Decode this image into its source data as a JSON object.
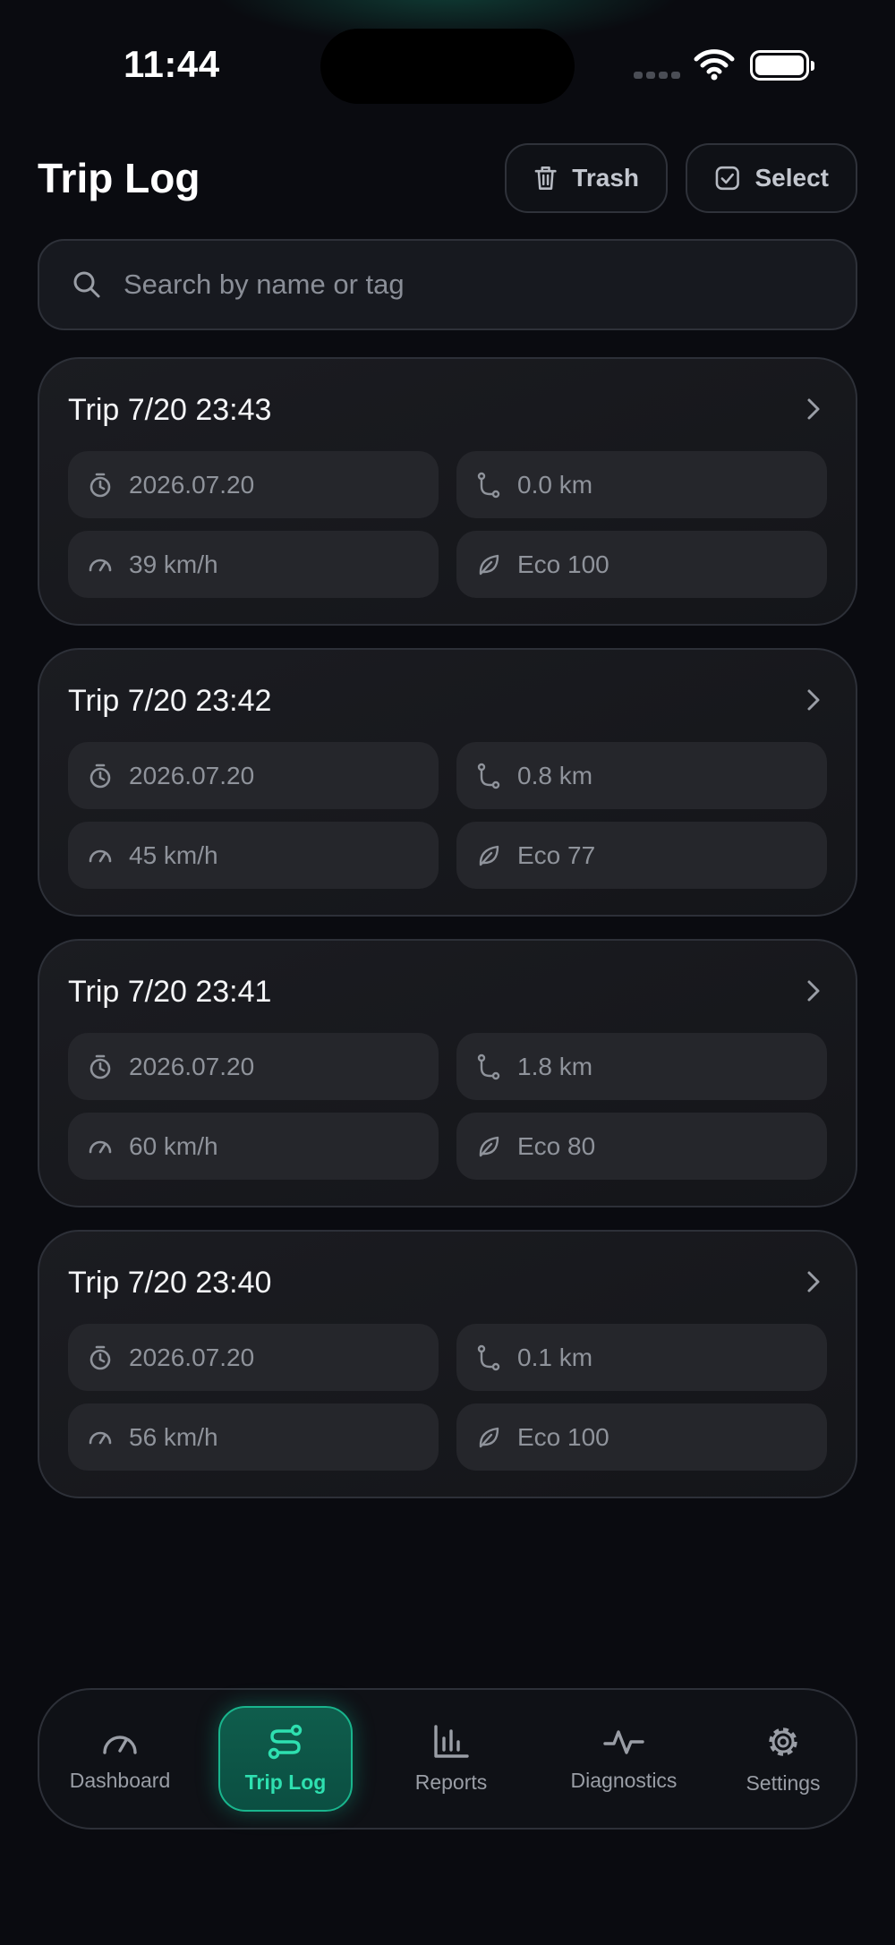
{
  "status_bar": {
    "time": "11:44"
  },
  "header": {
    "title": "Trip Log",
    "trash_label": "Trash",
    "select_label": "Select"
  },
  "search": {
    "placeholder": "Search by name or tag"
  },
  "trips": [
    {
      "name": "Trip 7/20 23:43",
      "date": "2026.07.20",
      "distance": "0.0 km",
      "speed": "39 km/h",
      "eco": "Eco 100"
    },
    {
      "name": "Trip 7/20 23:42",
      "date": "2026.07.20",
      "distance": "0.8 km",
      "speed": "45 km/h",
      "eco": "Eco 77"
    },
    {
      "name": "Trip 7/20 23:41",
      "date": "2026.07.20",
      "distance": "1.8 km",
      "speed": "60 km/h",
      "eco": "Eco 80"
    },
    {
      "name": "Trip 7/20 23:40",
      "date": "2026.07.20",
      "distance": "0.1 km",
      "speed": "56 km/h",
      "eco": "Eco 100"
    }
  ],
  "nav": [
    {
      "label": "Dashboard",
      "icon": "gauge-icon",
      "active": false
    },
    {
      "label": "Trip Log",
      "icon": "route-icon",
      "active": true
    },
    {
      "label": "Reports",
      "icon": "bar-chart-icon",
      "active": false
    },
    {
      "label": "Diagnostics",
      "icon": "pulse-icon",
      "active": false
    },
    {
      "label": "Settings",
      "icon": "gear-icon",
      "active": false
    }
  ],
  "colors": {
    "background": "#0a0b10",
    "card": "#1b1c21",
    "chip": "#25262b",
    "accent": "#2ee0b0",
    "accent_bg": "#0f5d4c"
  }
}
